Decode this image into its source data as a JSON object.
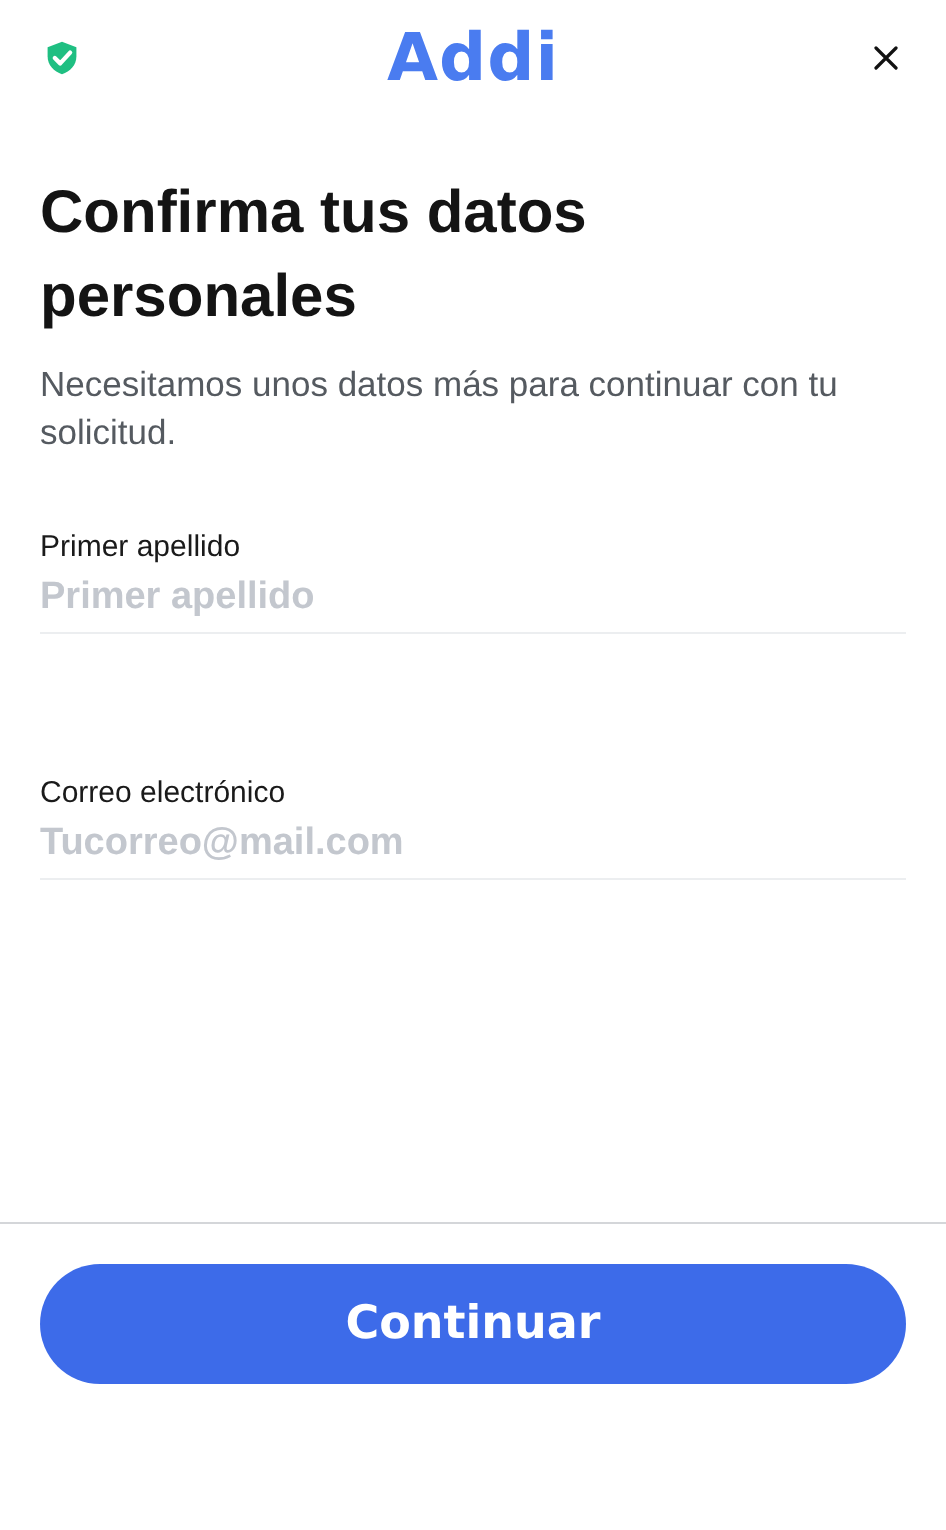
{
  "header": {
    "logo": "Addi"
  },
  "title": "Confirma tus datos personales",
  "subtitle": "Necesitamos unos datos más para continuar con tu solicitud.",
  "fields": [
    {
      "label": "Primer apellido",
      "placeholder": "Primer apellido"
    },
    {
      "label": "Correo electrónico",
      "placeholder": "Tucorreo@mail.com"
    }
  ],
  "button": "Continuar"
}
